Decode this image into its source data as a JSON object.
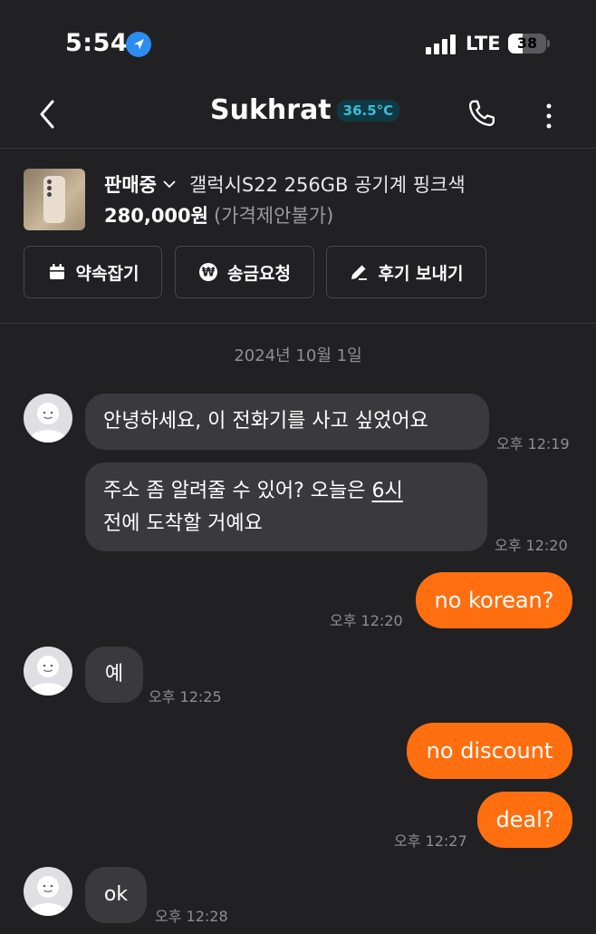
{
  "status_bar": {
    "time": "5:54",
    "network": "LTE",
    "battery": "38",
    "battery_level": 0.38
  },
  "header": {
    "title": "Sukhrat",
    "temperature": "36.5°C"
  },
  "product": {
    "status": "판매중",
    "name": "갤럭시S22 256GB 공기계 핑크색",
    "price": "280,000원",
    "price_note": "(가격제안불가)"
  },
  "actions": {
    "appointment": "약속잡기",
    "money_request": "송금요청",
    "review": "후기 보내기"
  },
  "chat": {
    "date": "2024년 10월 1일",
    "messages": [
      {
        "side": "in",
        "text": "안녕하세요, 이 전화기를 사고 싶었어요",
        "time": "오후 12:19"
      },
      {
        "side": "in",
        "text_line1a": "주소 좀 알려줄 수 있어?  오늘은 ",
        "text_line1u": "6시",
        "text_line2": "전에 도착할 거예요",
        "time": "오후 12:20"
      },
      {
        "side": "out",
        "text": "no korean?",
        "time": "오후 12:20"
      },
      {
        "side": "in",
        "text": "예",
        "time": "오후 12:25"
      },
      {
        "side": "out",
        "text": "no discount"
      },
      {
        "side": "out",
        "text": "deal?",
        "time": "오후 12:27"
      },
      {
        "side": "in",
        "text": "ok",
        "time": "오후 12:28"
      }
    ]
  },
  "colors": {
    "background": "#212124",
    "bubble_in": "#3a3a3e",
    "bubble_out": "#ff6f0f",
    "temp_badge": "#3fb9d6",
    "location_icon": "#2d8cf0"
  },
  "icons": [
    "location-arrow-icon",
    "signal-icon",
    "battery-icon",
    "back-icon",
    "phone-icon",
    "more-icon",
    "chevron-down-icon",
    "calendar-icon",
    "won-icon",
    "pencil-icon",
    "avatar-icon"
  ]
}
